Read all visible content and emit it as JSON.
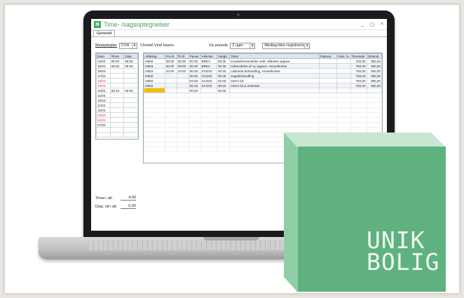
{
  "app": {
    "title": "Time- /sagsoptegnelser",
    "tab": "Generelt",
    "window_buttons": [
      "_",
      "▢",
      "×"
    ]
  },
  "filters": {
    "medarbejder_label": "Medarbejder",
    "medarbejder_value": "CVH",
    "medarbejder_name": "Christel Vind Hasris",
    "vis_periode_label": "Vis periode",
    "vis_periode_value": "2 uger",
    "option_value": "Medtag ikke-registreringer"
  },
  "left_grid": {
    "headers": [
      "Dato",
      "Timer",
      "Disp."
    ],
    "rows": [
      {
        "dato": "24/03",
        "timer": "08:00",
        "disp": "08:00",
        "red": false
      },
      {
        "dato": "15/03",
        "timer": "08:00",
        "disp": "08:00",
        "red": false
      },
      {
        "dato": "16/03",
        "timer": "",
        "disp": "",
        "red": false
      },
      {
        "dato": "17/03",
        "timer": "",
        "disp": "",
        "red": false
      },
      {
        "dato": "18/03",
        "timer": "",
        "disp": "",
        "red": true
      },
      {
        "dato": "19/03",
        "timer": "",
        "disp": "",
        "red": true
      },
      {
        "dato": "14/03",
        "timer": "00:16",
        "disp": "09:00",
        "red": false
      },
      {
        "dato": "11/03",
        "timer": "",
        "disp": "",
        "red": false
      },
      {
        "dato": "10/03",
        "timer": "",
        "disp": "",
        "red": false
      },
      {
        "dato": "11/03",
        "timer": "",
        "disp": "",
        "red": false
      },
      {
        "dato": "15/03",
        "timer": "",
        "disp": "",
        "red": false
      },
      {
        "dato": "03/03",
        "timer": "",
        "disp": "",
        "red": true
      },
      {
        "dato": "04/03",
        "timer": "",
        "disp": "",
        "red": true
      },
      {
        "dato": "07/03",
        "timer": "",
        "disp": "",
        "red": false
      }
    ]
  },
  "main_grid": {
    "headers": [
      "Afdeling",
      "Fra kl.",
      "Til kl.",
      "Pause",
      "Aktivitet",
      "Varigh.",
      "Tekst",
      "Faktura",
      "Fakt. %",
      "Timesats",
      "Omkost."
    ],
    "rows": [
      {
        "c": [
          "HB02",
          "08:00",
          "08:30",
          "00:30",
          "BREV",
          "00:30",
          "Kundehenvendelse vedr. afsluttet opgave",
          "",
          "",
          "750,00",
          "350,00"
        ]
      },
      {
        "c": [
          "HB03",
          "08:30",
          "09:00",
          "00:30",
          "BREV",
          "00:30",
          "Udsendelse af ny opgave, Hovedkontor",
          "",
          "",
          "750,00",
          "350,00"
        ]
      },
      {
        "c": [
          "HB03",
          "10:00",
          "10:45",
          "00:30",
          "SAG03",
          "00:30",
          "Løbende behandling, Hovedkontor",
          "",
          "",
          "750,00",
          "350,00"
        ]
      },
      {
        "c": [
          "HB02",
          "",
          "",
          "00:45",
          "SAG03",
          "00:45",
          "Sagsbehandling",
          "",
          "",
          "750,00",
          "350,00"
        ]
      },
      {
        "c": [
          "HB02",
          "",
          "",
          "01:00",
          "SAG03",
          "01:00",
          "Intern tid",
          "",
          "",
          "750,00",
          "350,00"
        ]
      },
      {
        "c": [
          "HB02",
          "",
          "",
          "00:15",
          "SAG03",
          "00:15",
          "Intern tid & sekretær",
          "",
          "",
          "750,00",
          "350,00"
        ]
      }
    ],
    "new_row": [
      "",
      "",
      "",
      "00:00",
      "",
      "00:00"
    ]
  },
  "totals": {
    "timer_ialt_label": "Timer i alt",
    "timer_ialt_value": "4:00",
    "disp_ialt_label": "Disp. tid i alt",
    "disp_ialt_value": "0,00"
  },
  "brand": {
    "line1": "UNIK",
    "line2": "BOLIG",
    "color": "#5fb27f"
  }
}
